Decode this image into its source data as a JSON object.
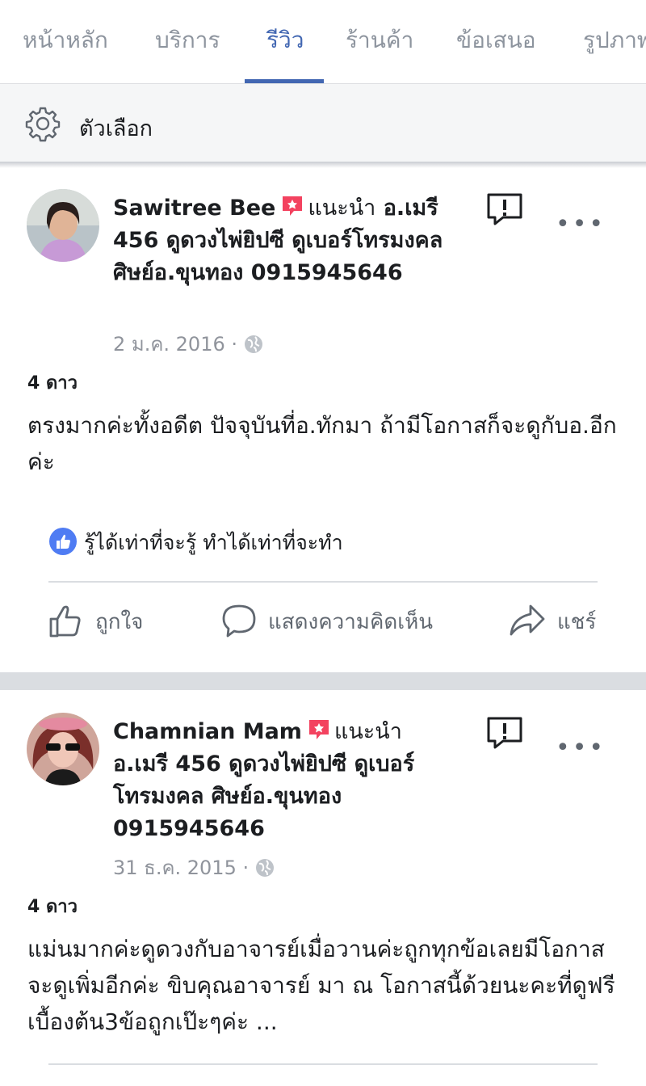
{
  "tabs": [
    {
      "label": "หน้าหลัก"
    },
    {
      "label": "บริการ"
    },
    {
      "label": "รีวิว"
    },
    {
      "label": "ร้านค้า"
    },
    {
      "label": "ข้อเสนอ"
    },
    {
      "label": "รูปภาพ"
    }
  ],
  "options": {
    "label": "ตัวเลือก"
  },
  "reviews": [
    {
      "name": "Sawitree Bee",
      "recommends": "แนะนำ",
      "page_name": "อ.เมรี 456 ดูดวงไพ่ยิปซี ดูเบอร์โทรมงคล ศิษย์อ.ขุนทอง 0915945646",
      "date": "2 ม.ค. 2016 ·",
      "rating": "4 ดาว",
      "text": "ตรงมากค่ะทั้งอดีต ปัจจุบันที่อ.ทักมา ถ้ามีโอกาสก็จะดูกับอ.อีกค่ะ",
      "reply": "รู้ได้เท่าที่จะรู้ ทำได้เท่าที่จะทำ"
    },
    {
      "name": "Chamnian Mam",
      "recommends": "แนะนำ",
      "page_name": "อ.เมรี 456 ดูดวงไพ่ยิปซี ดูเบอร์โทรมงคล ศิษย์อ.ขุนทอง 0915945646",
      "date": "31 ธ.ค. 2015 ·",
      "rating": "4 ดาว",
      "text": "แม่นมากค่ะดูดวงกับอาจารย์เมื่อวานค่ะถูกทุกข้อเลยมีโอกาสจะดูเพิ่มอีกค่ะ  ขิบคุณอาจารย์  มา ณ โอกาสนี้ด้วยนะคะที่ดูฟรีเบื้องต้น3ข้อถูกเป๊ะๆค่ะ  ..."
    }
  ],
  "actions": {
    "like": "ถูกใจ",
    "comment": "แสดงความคิดเห็น",
    "share": "แชร์"
  },
  "icons": {
    "gear": "gear-icon",
    "recommend": "recommend-icon",
    "globe": "globe-icon",
    "report": "report-icon",
    "more": "more-icon",
    "like": "thumbs-up-icon",
    "comment": "comment-icon",
    "share": "share-icon"
  },
  "colors": {
    "accent": "#4267b2",
    "recommend": "#f3425f",
    "muted": "#90949c"
  }
}
